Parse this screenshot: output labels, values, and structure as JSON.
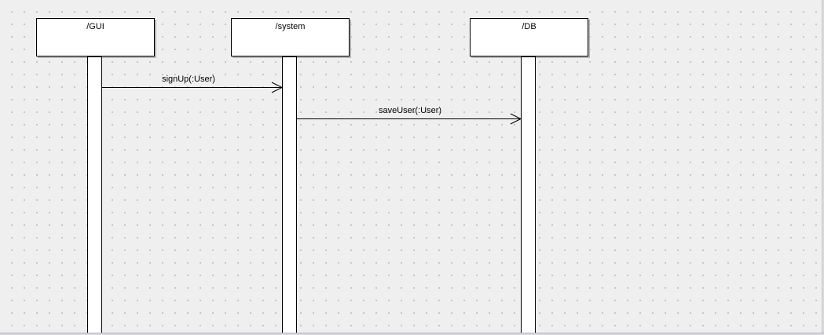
{
  "lifelines": [
    {
      "label": "/GUI"
    },
    {
      "label": "/system"
    },
    {
      "label": "/DB"
    }
  ],
  "messages": [
    {
      "label": "signUp(:User)",
      "from": "/GUI",
      "to": "/system"
    },
    {
      "label": "saveUser(:User)",
      "from": "/system",
      "to": "/DB"
    }
  ]
}
